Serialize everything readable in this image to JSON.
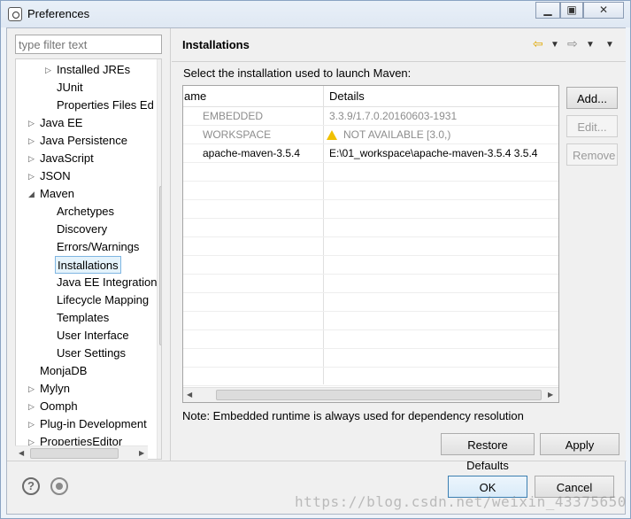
{
  "window": {
    "title": "Preferences",
    "controls": [
      "minimize-icon",
      "maximize-icon",
      "close-icon"
    ]
  },
  "filter": {
    "placeholder": "type filter text"
  },
  "tree": {
    "items": [
      {
        "label": "Installed JREs",
        "expanded": false
      },
      {
        "label": "JUnit"
      },
      {
        "label": "Properties Files Ed"
      },
      {
        "label": "Java EE",
        "expanded": false
      },
      {
        "label": "Java Persistence",
        "expanded": false
      },
      {
        "label": "JavaScript",
        "expanded": false
      },
      {
        "label": "JSON",
        "expanded": false
      },
      {
        "label": "Maven",
        "expanded": true
      },
      {
        "label": "Archetypes"
      },
      {
        "label": "Discovery"
      },
      {
        "label": "Errors/Warnings"
      },
      {
        "label": "Installations",
        "selected": true
      },
      {
        "label": "Java EE Integration"
      },
      {
        "label": "Lifecycle Mapping"
      },
      {
        "label": "Templates"
      },
      {
        "label": "User Interface"
      },
      {
        "label": "User Settings"
      },
      {
        "label": "MonjaDB"
      },
      {
        "label": "Mylyn",
        "expanded": false
      },
      {
        "label": "Oomph",
        "expanded": false
      },
      {
        "label": "Plug-in Development",
        "expanded": false
      },
      {
        "label": "PropertiesEditor",
        "expanded": false
      }
    ]
  },
  "page": {
    "title": "Installations",
    "description": "Select the installation used to launch Maven:",
    "note": "Note: Embedded runtime is always used for dependency resolution",
    "nav_icons": [
      "back-arrow-icon",
      "dropdown-icon",
      "forward-arrow-icon",
      "dropdown-icon",
      "view-menu-icon"
    ]
  },
  "table": {
    "columns": [
      "ame",
      "Details"
    ],
    "rows": [
      {
        "name": "EMBEDDED",
        "details": "3.3.9/1.7.0.20160603-1931",
        "disabled": true
      },
      {
        "name": "WORKSPACE",
        "details": "NOT AVAILABLE [3.0,)",
        "disabled": true,
        "warning": true
      },
      {
        "name": "apache-maven-3.5.4",
        "details": "E:\\01_workspace\\apache-maven-3.5.4 3.5.4",
        "disabled": false
      }
    ]
  },
  "buttons": {
    "add": "Add...",
    "edit": "Edit...",
    "remove": "Remove",
    "restore_defaults": "Restore Defaults",
    "apply": "Apply",
    "ok": "OK",
    "cancel": "Cancel"
  },
  "footer_icons": [
    "help-icon",
    "record-icon"
  ],
  "watermark": "https://blog.csdn.net/weixin_43375650",
  "colors": {
    "accent": "#3c7fb1",
    "selection": "#e5f3fb",
    "warning": "#f0c000"
  }
}
